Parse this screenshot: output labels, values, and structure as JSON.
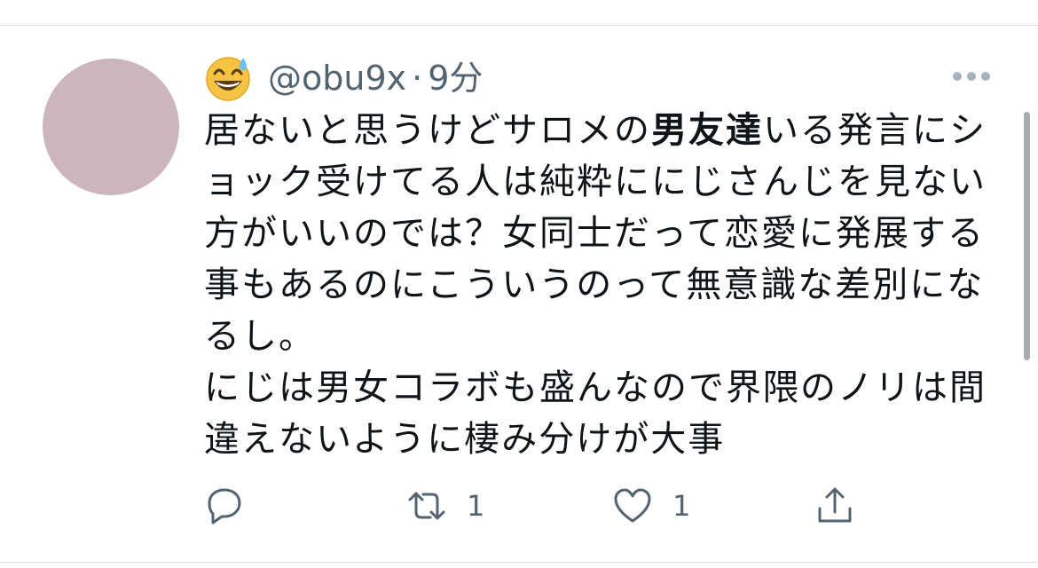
{
  "tweet": {
    "handle": "@obu9x",
    "separator": "·",
    "time": "9分",
    "text": {
      "part1": "居ないと思うけどサロメの",
      "bold": "男友達",
      "part2": "いる発言にショック受けてる人は純粋ににじさんじを見ない方がいいのでは？女同士だって恋愛に発展する事もあるのにこういうのって無意識な差別になるし。",
      "line2": "にじは男女コラボも盛んなので界隈のノリは間違えないように棲み分けが大事"
    },
    "emoji": "grinning-face-with-sweat-icon",
    "actions": {
      "reply_icon": "reply-icon",
      "retweet_icon": "retweet-icon",
      "retweet_count": "1",
      "like_icon": "heart-icon",
      "like_count": "1",
      "share_icon": "share-icon"
    }
  },
  "colors": {
    "secondary_text": "#536471",
    "avatar": "#cbb7bb",
    "divider": "#dfe3e6"
  }
}
